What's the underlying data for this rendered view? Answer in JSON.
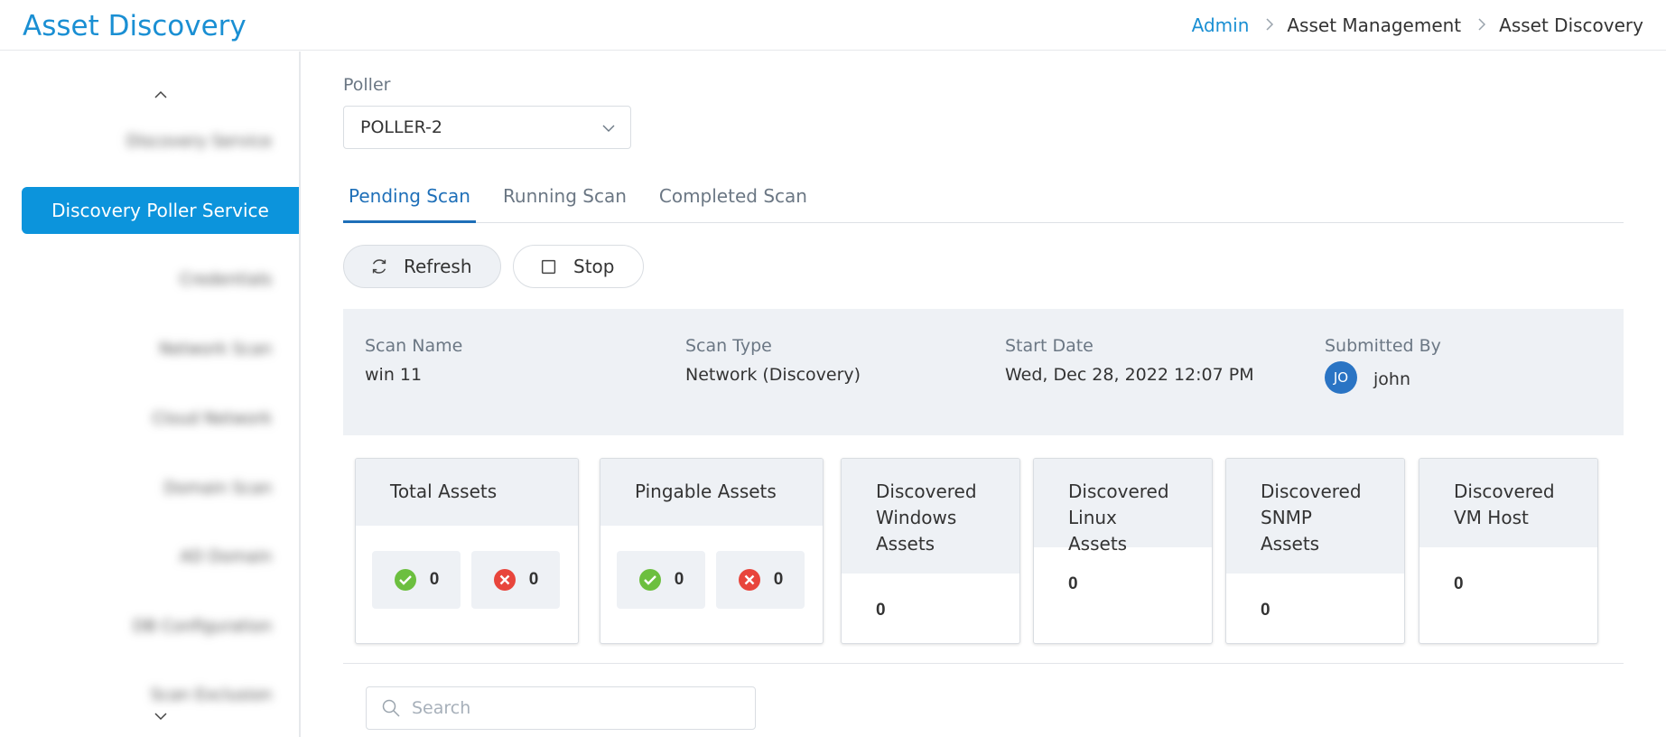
{
  "header": {
    "title": "Asset Discovery",
    "breadcrumb": [
      "Admin",
      "Asset Management",
      "Asset Discovery"
    ]
  },
  "sidebar": {
    "items": [
      {
        "label": "Discovery Service",
        "active": false
      },
      {
        "label": "Discovery Poller Service",
        "active": true
      },
      {
        "label": "Credentials",
        "active": false
      },
      {
        "label": "Network Scan",
        "active": false
      },
      {
        "label": "Cloud Network",
        "active": false
      },
      {
        "label": "Domain Scan",
        "active": false
      },
      {
        "label": "AD Domain",
        "active": false
      },
      {
        "label": "DB Configuration",
        "active": false
      },
      {
        "label": "Scan Exclusion",
        "active": false
      }
    ]
  },
  "poller": {
    "label": "Poller",
    "value": "POLLER-2"
  },
  "tabs": [
    {
      "label": "Pending Scan",
      "active": true
    },
    {
      "label": "Running Scan",
      "active": false
    },
    {
      "label": "Completed Scan",
      "active": false
    }
  ],
  "actions": {
    "refresh": "Refresh",
    "stop": "Stop"
  },
  "scan": {
    "name_label": "Scan Name",
    "name": "win 11",
    "type_label": "Scan Type",
    "type": "Network (Discovery)",
    "start_label": "Start Date",
    "start": "Wed, Dec 28, 2022 12:07 PM",
    "submitted_label": "Submitted By",
    "submitted_initials": "JO",
    "submitted_by": "john"
  },
  "stats": {
    "total": {
      "label": "Total Assets",
      "ok": "0",
      "fail": "0"
    },
    "pingable": {
      "label": "Pingable Assets",
      "ok": "0",
      "fail": "0"
    },
    "windows": {
      "label": "Discovered Windows Assets",
      "value": "0"
    },
    "linux": {
      "label": "Discovered Linux Assets",
      "value": "0"
    },
    "snmp": {
      "label": "Discovered SNMP Assets",
      "value": "0"
    },
    "vmhost": {
      "label": "Discovered VM Host",
      "value": "0"
    }
  },
  "search": {
    "placeholder": "Search"
  },
  "colors": {
    "accent": "#1a8fd3",
    "active_nav": "#0c94dc",
    "success": "#6cbf3f",
    "error": "#e8453c",
    "panel_bg": "#eef1f5"
  }
}
